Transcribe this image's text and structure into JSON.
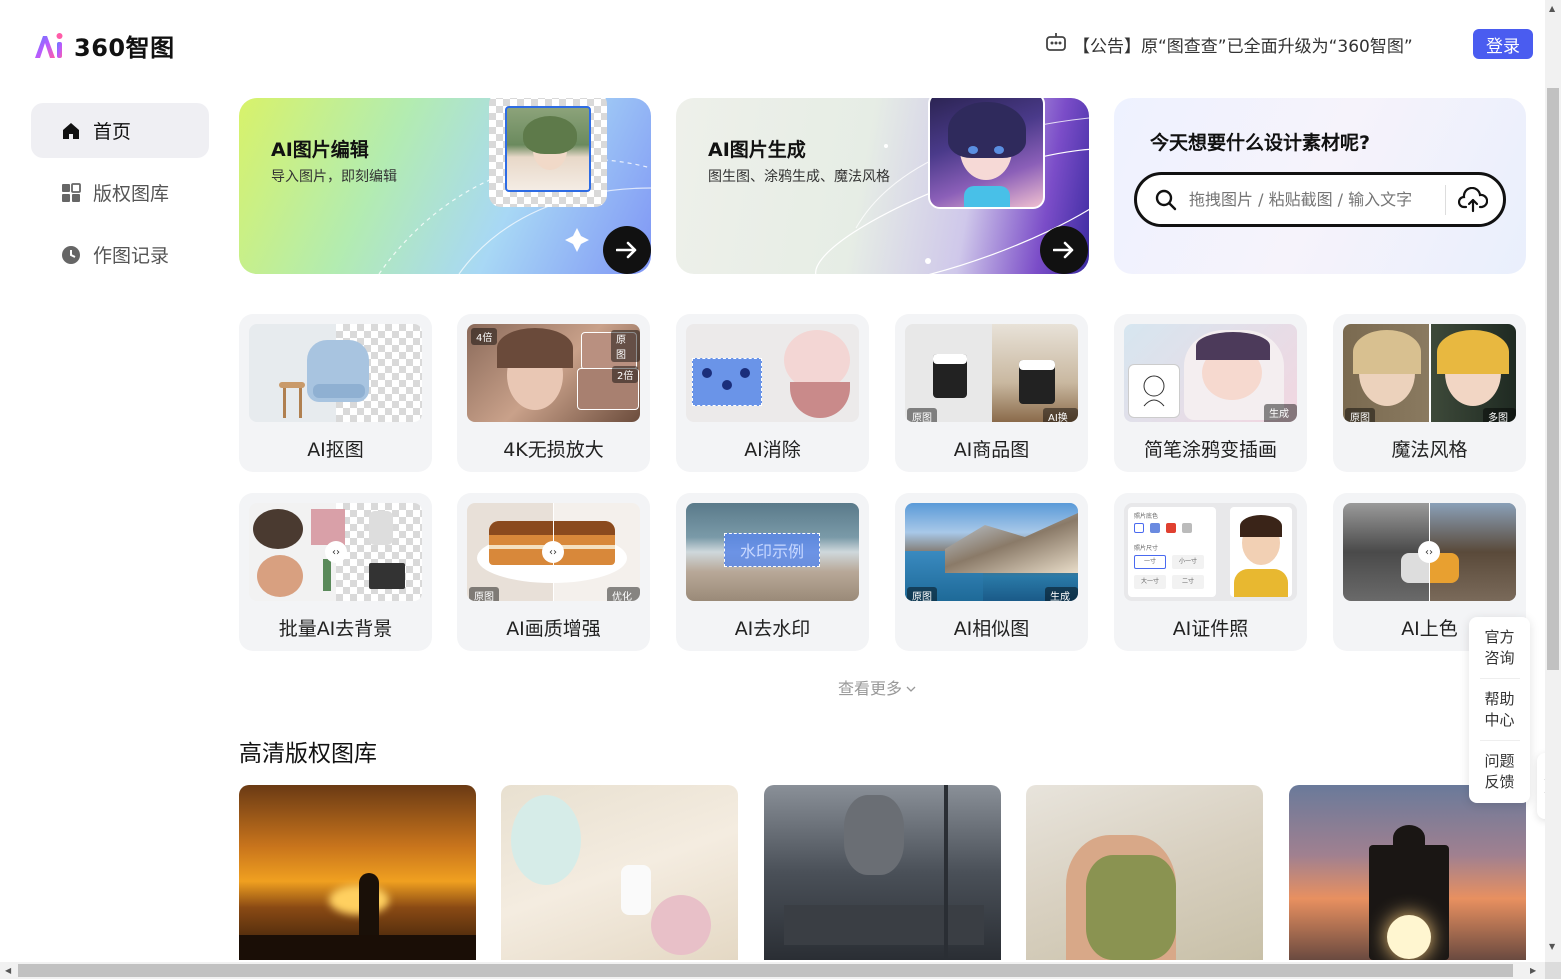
{
  "header": {
    "logo_text": "360智图",
    "notice": "【公告】原“图查查”已全面升级为“360智图”",
    "login_label": "登录",
    "accent": "#4a5cf0"
  },
  "sidebar": {
    "items": [
      {
        "label": "首页",
        "icon": "home-icon",
        "active": true
      },
      {
        "label": "版权图库",
        "icon": "grid-icon",
        "active": false
      },
      {
        "label": "作图记录",
        "icon": "clock-icon",
        "active": false
      }
    ]
  },
  "banners": {
    "edit": {
      "title": "AI图片编辑",
      "subtitle": "导入图片，即刻编辑"
    },
    "generate": {
      "title": "AI图片生成",
      "subtitle": "图生图、涂鸦生成、魔法风格"
    },
    "search": {
      "title": "今天想要什么设计素材呢?",
      "placeholder": "拖拽图片 / 粘贴截图 / 输入文字"
    }
  },
  "tools": [
    {
      "label": "AI抠图"
    },
    {
      "label": "4K无损放大",
      "tags": [
        "4倍",
        "原图",
        "2倍"
      ]
    },
    {
      "label": "AI消除"
    },
    {
      "label": "AI商品图",
      "tags": [
        "原图",
        "AI换背景"
      ]
    },
    {
      "label": "简笔涂鸦变插画",
      "tags": [
        "生成后"
      ]
    },
    {
      "label": "魔法风格",
      "tags": [
        "原图",
        "多图案"
      ]
    },
    {
      "label": "批量AI去背景"
    },
    {
      "label": "AI画质增强",
      "tags": [
        "原图",
        "优化后"
      ]
    },
    {
      "label": "AI去水印",
      "watermark": "水印示例"
    },
    {
      "label": "AI相似图",
      "tags": [
        "原图",
        "生成图"
      ]
    },
    {
      "label": "AI证件照",
      "id_labels": [
        "照片底色",
        "照片尺寸",
        "一寸",
        "小一寸",
        "大一寸",
        "二寸"
      ]
    },
    {
      "label": "AI上色"
    }
  ],
  "more_label": "查看更多",
  "gallery": {
    "title": "高清版权图库"
  },
  "float_panel": {
    "items": [
      "官方咨询",
      "帮助中心",
      "问题反馈"
    ]
  }
}
